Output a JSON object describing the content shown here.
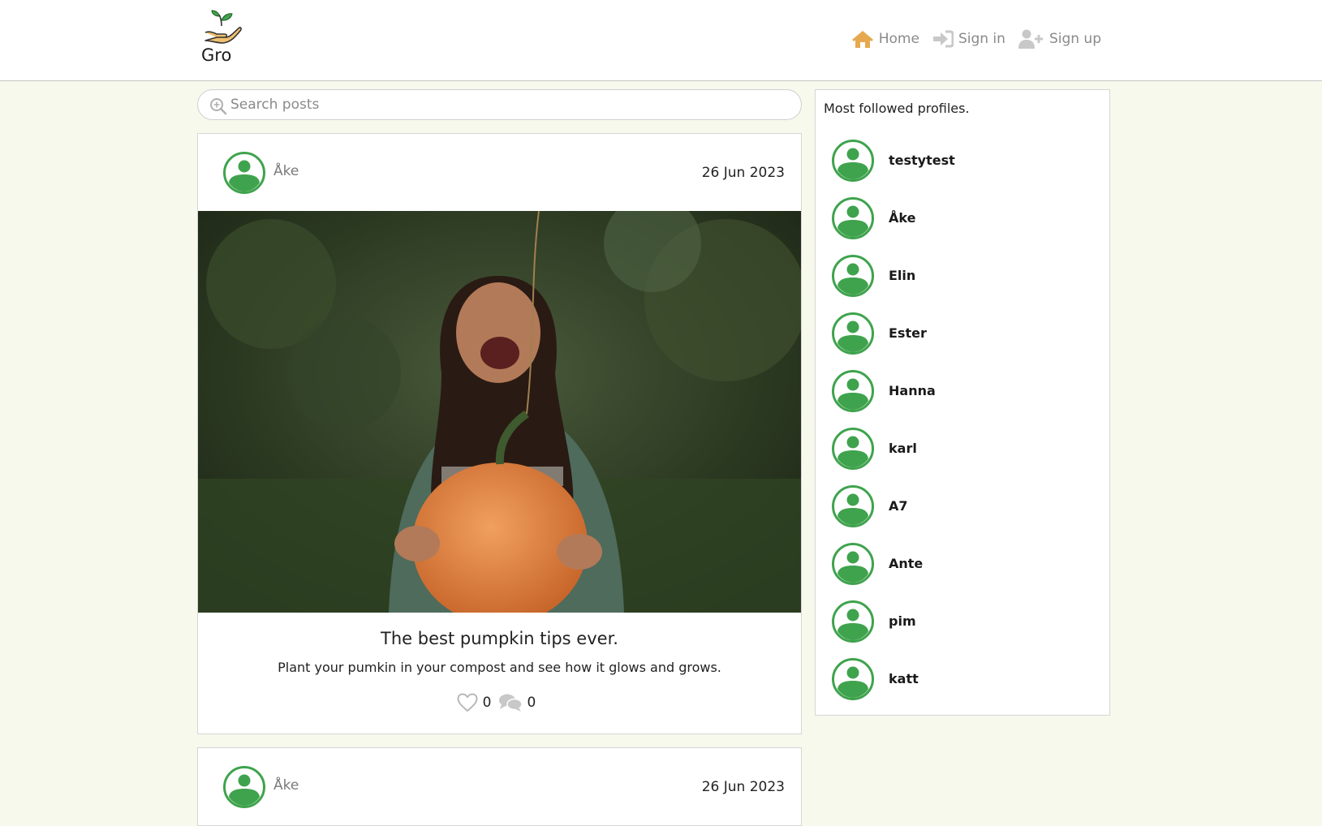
{
  "brand": {
    "name": "Gro"
  },
  "nav": {
    "home": "Home",
    "signin": "Sign in",
    "signup": "Sign up"
  },
  "search": {
    "placeholder": "Search posts",
    "value": ""
  },
  "posts": [
    {
      "author": "Åke",
      "date": "26 Jun 2023",
      "title": "The best pumpkin tips ever.",
      "text": "Plant your pumkin in your compost and see how it glows and grows.",
      "likes": "0",
      "comments": "0"
    },
    {
      "author": "Åke",
      "date": "26 Jun 2023"
    }
  ],
  "sidebar": {
    "title": "Most followed profiles.",
    "profiles": [
      "testytest",
      "Åke",
      "Elin",
      "Ester",
      "Hanna",
      "karl",
      "A7",
      "Ante",
      "pim",
      "katt"
    ]
  },
  "colors": {
    "avatar_green": "#3fa34d",
    "nav_icon": "#e6a94f",
    "background": "#f6f9ec"
  },
  "icons": [
    "logo-plant-hand-icon",
    "home-icon",
    "sign-in-icon",
    "user-plus-icon",
    "search-icon",
    "avatar-icon",
    "heart-icon",
    "comments-icon"
  ]
}
